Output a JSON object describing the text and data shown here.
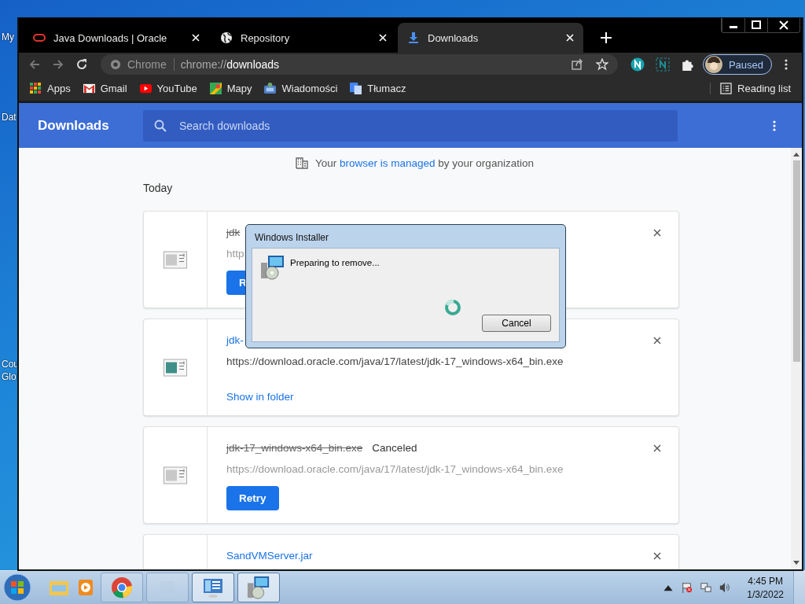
{
  "desktop": {
    "icon_labels": [
      "My",
      "Dat",
      "Cou",
      "Glo"
    ]
  },
  "tabs": [
    {
      "title": "Java Downloads | Oracle",
      "kind": "oracle",
      "selected": false
    },
    {
      "title": "Repository",
      "kind": "globe",
      "selected": false
    },
    {
      "title": "Downloads",
      "kind": "download",
      "selected": true
    }
  ],
  "address_bar": {
    "chip": "Chrome",
    "url_prefix": "chrome://",
    "url_host": "downloads"
  },
  "profile": {
    "label": "Paused"
  },
  "bookmarks": [
    {
      "label": "Apps",
      "kind": "apps"
    },
    {
      "label": "Gmail",
      "kind": "gmail"
    },
    {
      "label": "YouTube",
      "kind": "youtube"
    },
    {
      "label": "Mapy",
      "kind": "maps"
    },
    {
      "label": "Wiadomości",
      "kind": "news"
    },
    {
      "label": "Tłumacz",
      "kind": "translate"
    }
  ],
  "reading_list": "Reading list",
  "page": {
    "title": "Downloads",
    "search_placeholder": "Search downloads",
    "managed_prefix": "Your",
    "managed_link": "browser is managed",
    "managed_suffix": "by your organization",
    "section": "Today"
  },
  "downloads": [
    {
      "file": "jdk",
      "canceled": true,
      "url": "http",
      "action": {
        "kind": "button",
        "label": "R"
      }
    },
    {
      "file": "jdk-",
      "canceled": false,
      "url": "https://download.oracle.com/java/17/latest/jdk-17_windows-x64_bin.exe",
      "action": {
        "kind": "link",
        "label": "Show in folder"
      }
    },
    {
      "file": "jdk-17_windows-x64_bin.exe",
      "canceled": true,
      "status": "Canceled",
      "url": "https://download.oracle.com/java/17/latest/jdk-17_windows-x64_bin.exe",
      "action": {
        "kind": "button",
        "label": "Retry"
      }
    },
    {
      "file": "SandVMServer.jar",
      "canceled": false
    }
  ],
  "dialog": {
    "title": "Windows Installer",
    "message": "Preparing to remove...",
    "button": "Cancel"
  },
  "taskbar": {
    "time": "4:45 PM",
    "date": "1/3/2022"
  }
}
